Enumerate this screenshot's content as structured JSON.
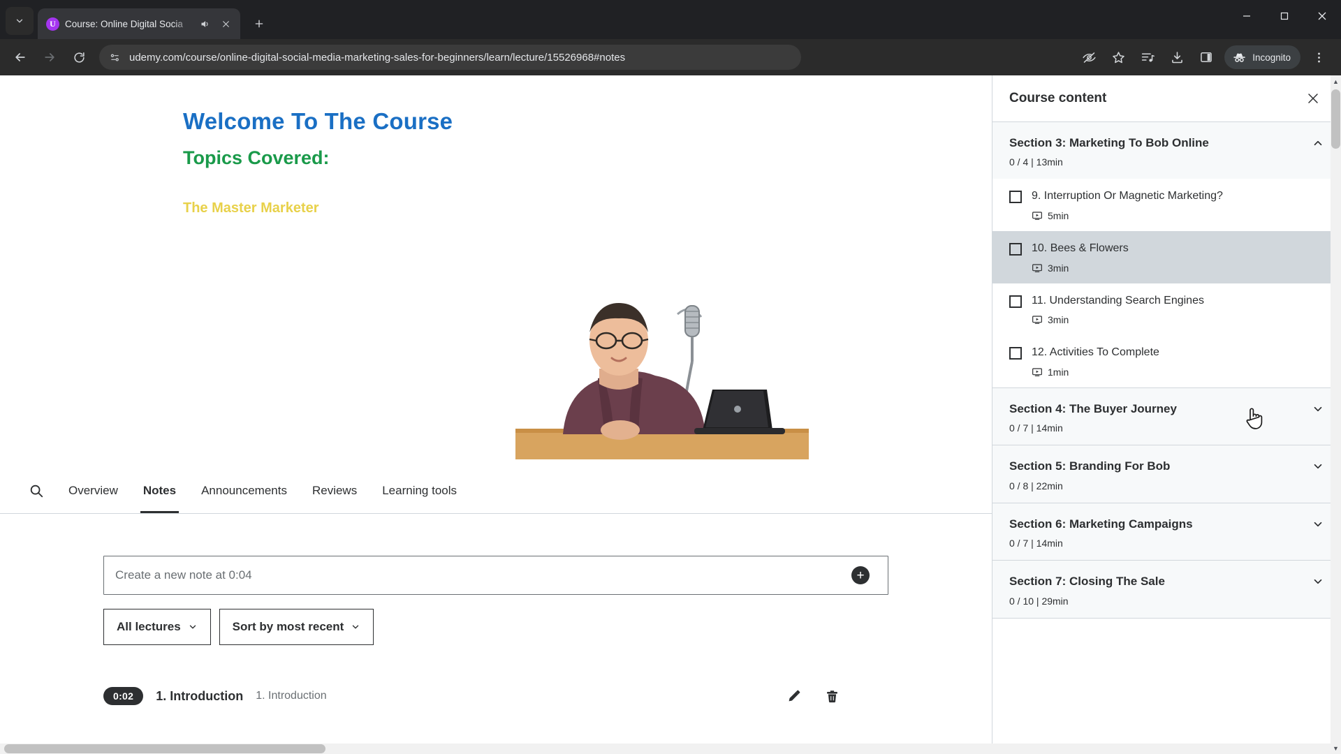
{
  "browser": {
    "tab": {
      "title": "Course: Online Digital Socia",
      "favicon_letter": "U",
      "audio_icon": "speaker-icon",
      "close_icon": "close-icon"
    },
    "new_tab_label": "+",
    "tab_search_icon": "chevron-down-icon",
    "window_controls": {
      "minimize": "−",
      "maximize": "□",
      "close": "✕"
    },
    "nav": {
      "back": "back-icon",
      "forward": "forward-icon",
      "reload": "reload-icon"
    },
    "omnibox": {
      "url": "udemy.com/course/online-digital-social-media-marketing-sales-for-beginners/learn/lecture/15526968#notes",
      "site_info_icon": "page-info-icon"
    },
    "toolbar_right": {
      "tracking_icon": "eye-slash-icon",
      "bookmark_icon": "star-icon",
      "media_icon": "media-playlist-icon",
      "downloads_icon": "download-icon",
      "side_panel_icon": "side-panel-icon",
      "incognito_label": "Incognito",
      "incognito_icon": "incognito-hat-icon",
      "menu_icon": "three-dots-icon"
    }
  },
  "slide": {
    "title": "Welcome To The Course",
    "subtitle": "Topics Covered:",
    "bullet": "The Master Marketer",
    "title_color": "#1a6fc4",
    "subtitle_color": "#1a9a4a",
    "bullet_color": "#e8d14a"
  },
  "tabs": {
    "search_icon": "search-icon",
    "items": [
      {
        "label": "Overview",
        "active": false
      },
      {
        "label": "Notes",
        "active": true
      },
      {
        "label": "Announcements",
        "active": false
      },
      {
        "label": "Reviews",
        "active": false
      },
      {
        "label": "Learning tools",
        "active": false
      }
    ]
  },
  "notes": {
    "input_placeholder": "Create a new note at 0:04",
    "add_icon": "plus-circle-icon",
    "filter_lectures": "All lectures",
    "filter_sort": "Sort by most recent",
    "chevron_icon": "chevron-down-icon",
    "rows": [
      {
        "timestamp": "0:02",
        "lecture": "1. Introduction",
        "text": "1. Introduction",
        "edit_icon": "pencil-icon",
        "delete_icon": "trash-icon"
      }
    ]
  },
  "sidebar": {
    "title": "Course content",
    "close_icon": "close-icon",
    "sections": [
      {
        "name": "Section 3: Marketing To Bob Online",
        "meta": "0 / 4 | 13min",
        "expanded": true,
        "chevron": "chevron-up-icon",
        "lectures": [
          {
            "title": "9. Interruption Or Magnetic Marketing?",
            "duration": "5min",
            "type_icon": "video-icon",
            "checked": false,
            "hover": false
          },
          {
            "title": "10. Bees & Flowers",
            "duration": "3min",
            "type_icon": "video-icon",
            "checked": false,
            "hover": true
          },
          {
            "title": "11. Understanding Search Engines",
            "duration": "3min",
            "type_icon": "video-icon",
            "checked": false,
            "hover": false
          },
          {
            "title": "12. Activities To Complete",
            "duration": "1min",
            "type_icon": "video-icon",
            "checked": false,
            "hover": false
          }
        ]
      },
      {
        "name": "Section 4: The Buyer Journey",
        "meta": "0 / 7 | 14min",
        "expanded": false,
        "chevron": "chevron-down-icon",
        "lectures": []
      },
      {
        "name": "Section 5: Branding For Bob",
        "meta": "0 / 8 | 22min",
        "expanded": false,
        "chevron": "chevron-down-icon",
        "lectures": []
      },
      {
        "name": "Section 6: Marketing Campaigns",
        "meta": "0 / 7 | 14min",
        "expanded": false,
        "chevron": "chevron-down-icon",
        "lectures": []
      },
      {
        "name": "Section 7: Closing The Sale",
        "meta": "0 / 10 | 29min",
        "expanded": false,
        "chevron": "chevron-down-icon",
        "lectures": []
      }
    ]
  }
}
